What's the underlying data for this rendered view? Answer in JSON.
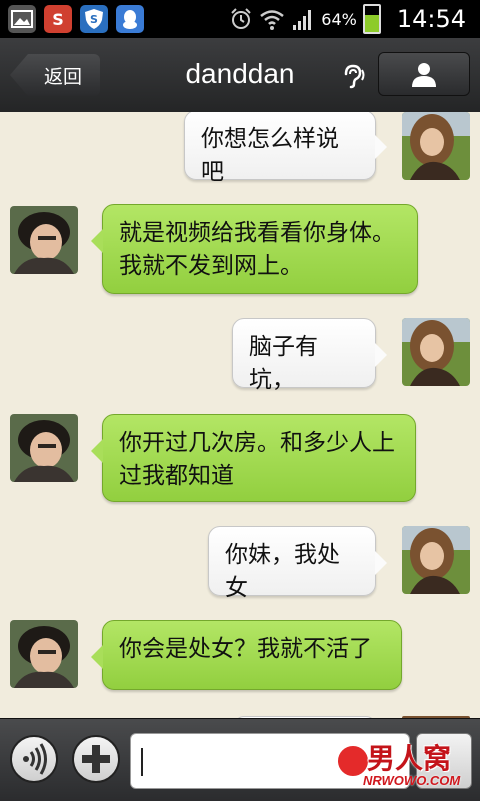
{
  "status_bar": {
    "battery_percent": "64%",
    "battery_level": 0.64,
    "time": "14:54",
    "notification_icons": [
      "gallery-icon",
      "sina-weibo-icon",
      "security-shield-icon",
      "qq-icon"
    ],
    "system_icons": [
      "alarm-icon",
      "wifi-icon",
      "signal-icon",
      "battery-icon"
    ]
  },
  "header": {
    "back_label": "返回",
    "title": "danddan",
    "earpiece_icon": "earpiece-mode-icon",
    "profile_icon": "person-icon"
  },
  "messages": [
    {
      "sender": "her",
      "text": "你想怎么样说吧"
    },
    {
      "sender": "him",
      "text": "就是视频给我看看你身体。我就不发到网上。"
    },
    {
      "sender": "her",
      "text": "脑子有坑，"
    },
    {
      "sender": "him",
      "text": "你开过几次房。和多少人上过我都知道"
    },
    {
      "sender": "her",
      "text": "你妹，我处女"
    },
    {
      "sender": "him",
      "text": "你会是处女？我就不活了"
    }
  ],
  "input_bar": {
    "voice_icon": "voice-input-icon",
    "add_icon": "plus-icon",
    "input_value": ""
  },
  "watermark": {
    "brand": "男人窝",
    "url": "NRWOWO.COM"
  },
  "colors": {
    "background": "#f1ecdd",
    "green_bubble": "#9ed84b",
    "white_bubble": "#ffffff",
    "header": "#2f3032"
  }
}
